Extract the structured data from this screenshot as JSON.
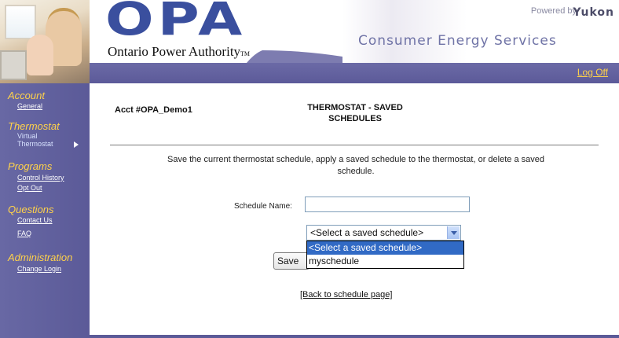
{
  "header": {
    "logo_text": "OPA",
    "org_name": "Ontario Power Authority",
    "org_tm": "TM",
    "powered_by": "Powered by",
    "yukon_logo": "Yukon",
    "service_name": "Consumer Energy Services",
    "logoff": "Log Off"
  },
  "sidebar": {
    "account": {
      "heading": "Account",
      "links": [
        "General"
      ]
    },
    "thermostat": {
      "heading": "Thermostat",
      "current_line1": "Virtual",
      "current_line2": "Thermostat"
    },
    "programs": {
      "heading": "Programs",
      "links": [
        "Control History",
        "Opt Out"
      ]
    },
    "questions": {
      "heading": "Questions",
      "links": [
        "Contact Us",
        "FAQ"
      ]
    },
    "administration": {
      "heading": "Administration",
      "links": [
        "Change Login"
      ]
    }
  },
  "main": {
    "account_number": "Acct #OPA_Demo1",
    "title_line1": "THERMOSTAT - SAVED",
    "title_line2": "SCHEDULES",
    "description": "Save the current thermostat schedule, apply a saved schedule to the thermostat, or delete a saved schedule.",
    "schedule_name_label": "Schedule Name:",
    "schedule_name_value": "",
    "select": {
      "selected": "<Select a saved schedule>",
      "options": [
        "<Select a saved schedule>",
        "myschedule"
      ]
    },
    "save_button": "Save",
    "back_link": "[Back to schedule page]"
  },
  "colors": {
    "nav_purple": "#5c5a99",
    "sidebar_heading": "#ffd24a",
    "logo_blue": "#3a4f9e",
    "select_highlight": "#316ac5"
  }
}
